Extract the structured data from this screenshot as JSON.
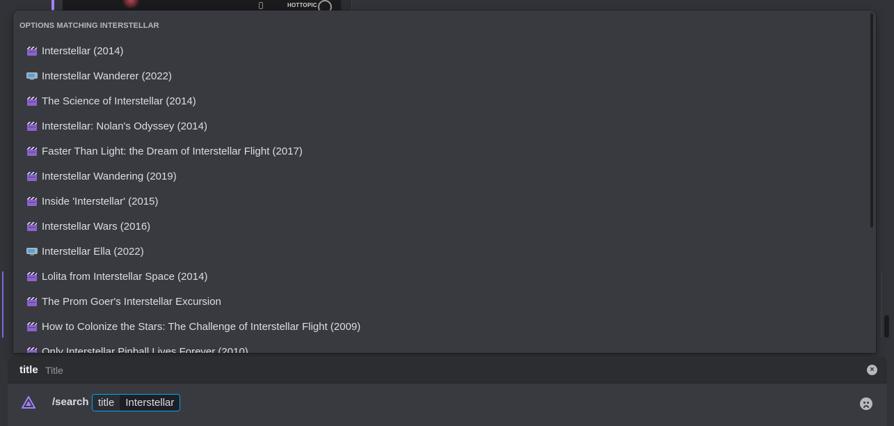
{
  "popup": {
    "header": "OPTIONS MATCHING INTERSTELLAR",
    "options": [
      {
        "icon": "movie-clapper-icon",
        "label": "Interstellar (2014)"
      },
      {
        "icon": "tv-icon",
        "label": "Interstellar Wanderer (2022)"
      },
      {
        "icon": "movie-clapper-icon",
        "label": "The Science of Interstellar (2014)"
      },
      {
        "icon": "movie-clapper-icon",
        "label": "Interstellar: Nolan's Odyssey (2014)"
      },
      {
        "icon": "movie-clapper-icon",
        "label": "Faster Than Light: the Dream of Interstellar Flight (2017)"
      },
      {
        "icon": "movie-clapper-icon",
        "label": "Interstellar Wandering (2019)"
      },
      {
        "icon": "movie-clapper-icon",
        "label": "Inside 'Interstellar' (2015)"
      },
      {
        "icon": "movie-clapper-icon",
        "label": "Interstellar Wars (2016)"
      },
      {
        "icon": "tv-icon",
        "label": "Interstellar Ella (2022)"
      },
      {
        "icon": "movie-clapper-icon",
        "label": "Lolita from Interstellar Space (2014)"
      },
      {
        "icon": "movie-clapper-icon",
        "label": "The Prom Goer's Interstellar Excursion"
      },
      {
        "icon": "movie-clapper-icon",
        "label": "How to Colonize the Stars: The Challenge of Interstellar Flight (2009)"
      },
      {
        "icon": "movie-clapper-icon",
        "label": "Only Interstellar Pinball Lives Forever (2010)"
      }
    ]
  },
  "embed_preview": {
    "brands": [
      "",
      "HOTTOPIC",
      ""
    ]
  },
  "param_info": {
    "name": "title",
    "description": "Title",
    "close_glyph": "×"
  },
  "input": {
    "command": "/search",
    "param_name": "title",
    "param_value": "Interstellar"
  },
  "colors": {
    "background": "#313338",
    "popup": "#383a40",
    "accent_blue": "#00a8fc",
    "accent_purple": "#a582ff"
  }
}
